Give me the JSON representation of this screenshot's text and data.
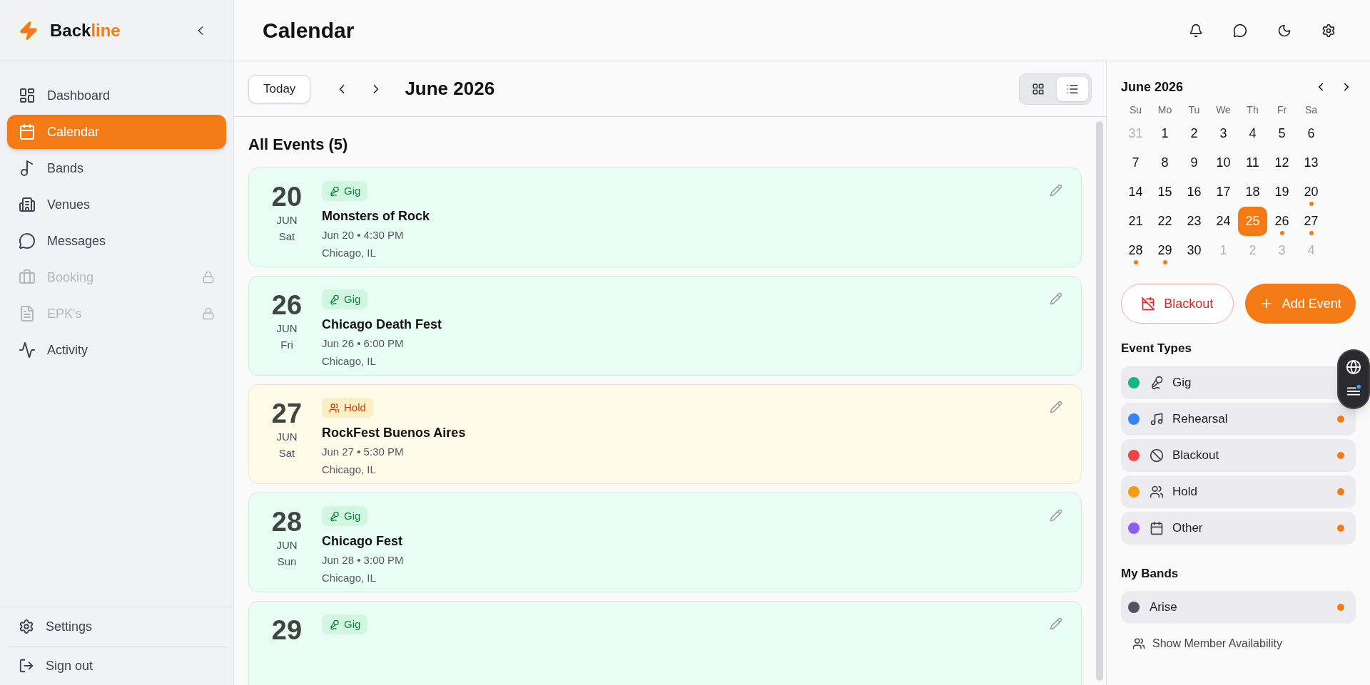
{
  "brand": {
    "primary": "Back",
    "accent": "line"
  },
  "sidebar": {
    "items": [
      {
        "label": "Dashboard",
        "selected": false,
        "locked": false
      },
      {
        "label": "Calendar",
        "selected": true,
        "locked": false
      },
      {
        "label": "Bands",
        "selected": false,
        "locked": false
      },
      {
        "label": "Venues",
        "selected": false,
        "locked": false
      },
      {
        "label": "Messages",
        "selected": false,
        "locked": false
      },
      {
        "label": "Booking",
        "selected": false,
        "locked": true
      },
      {
        "label": "EPK's",
        "selected": false,
        "locked": true
      },
      {
        "label": "Activity",
        "selected": false,
        "locked": false
      }
    ],
    "footer": [
      {
        "label": "Settings"
      },
      {
        "label": "Sign out"
      }
    ]
  },
  "page_title": "Calendar",
  "toolbar": {
    "today": "Today",
    "month": "June 2026",
    "views": [
      {
        "selected": false
      },
      {
        "selected": true
      }
    ]
  },
  "events": {
    "heading": "All Events (5)",
    "items": [
      {
        "kind": "gig",
        "day": "20",
        "month": "JUN",
        "weekday": "Sat",
        "tag": "Gig",
        "title": "Monsters of Rock",
        "time": "Jun 20 • 4:30 PM",
        "location": "Chicago, IL"
      },
      {
        "kind": "gig",
        "day": "26",
        "month": "JUN",
        "weekday": "Fri",
        "tag": "Gig",
        "title": "Chicago Death Fest",
        "time": "Jun 26 • 6:00 PM",
        "location": "Chicago, IL"
      },
      {
        "kind": "hold",
        "day": "27",
        "month": "JUN",
        "weekday": "Sat",
        "tag": "Hold",
        "title": "RockFest Buenos Aires",
        "time": "Jun 27 • 5:30 PM",
        "location": "Chicago, IL"
      },
      {
        "kind": "gig",
        "day": "28",
        "month": "JUN",
        "weekday": "Sun",
        "tag": "Gig",
        "title": "Chicago Fest",
        "time": "Jun 28 • 3:00 PM",
        "location": "Chicago, IL"
      },
      {
        "kind": "gig",
        "day": "29",
        "tag": "Gig"
      }
    ]
  },
  "mini_calendar": {
    "title": "June 2026",
    "weekdays": [
      "Su",
      "Mo",
      "Tu",
      "We",
      "Th",
      "Fr",
      "Sa"
    ],
    "weeks": [
      [
        {
          "day": "31",
          "muted": true,
          "selected": false,
          "event": false
        },
        {
          "day": "1",
          "muted": false,
          "selected": false,
          "event": false
        },
        {
          "day": "2",
          "muted": false,
          "selected": false,
          "event": false
        },
        {
          "day": "3",
          "muted": false,
          "selected": false,
          "event": false
        },
        {
          "day": "4",
          "muted": false,
          "selected": false,
          "event": false
        },
        {
          "day": "5",
          "muted": false,
          "selected": false,
          "event": false
        },
        {
          "day": "6",
          "muted": false,
          "selected": false,
          "event": false
        }
      ],
      [
        {
          "day": "7",
          "muted": false,
          "selected": false,
          "event": false
        },
        {
          "day": "8",
          "muted": false,
          "selected": false,
          "event": false
        },
        {
          "day": "9",
          "muted": false,
          "selected": false,
          "event": false
        },
        {
          "day": "10",
          "muted": false,
          "selected": false,
          "event": false
        },
        {
          "day": "11",
          "muted": false,
          "selected": false,
          "event": false
        },
        {
          "day": "12",
          "muted": false,
          "selected": false,
          "event": false
        },
        {
          "day": "13",
          "muted": false,
          "selected": false,
          "event": false
        }
      ],
      [
        {
          "day": "14",
          "muted": false,
          "selected": false,
          "event": false
        },
        {
          "day": "15",
          "muted": false,
          "selected": false,
          "event": false
        },
        {
          "day": "16",
          "muted": false,
          "selected": false,
          "event": false
        },
        {
          "day": "17",
          "muted": false,
          "selected": false,
          "event": false
        },
        {
          "day": "18",
          "muted": false,
          "selected": false,
          "event": false
        },
        {
          "day": "19",
          "muted": false,
          "selected": false,
          "event": false
        },
        {
          "day": "20",
          "muted": false,
          "selected": false,
          "event": true
        }
      ],
      [
        {
          "day": "21",
          "muted": false,
          "selected": false,
          "event": false
        },
        {
          "day": "22",
          "muted": false,
          "selected": false,
          "event": false
        },
        {
          "day": "23",
          "muted": false,
          "selected": false,
          "event": false
        },
        {
          "day": "24",
          "muted": false,
          "selected": false,
          "event": false
        },
        {
          "day": "25",
          "muted": false,
          "selected": true,
          "event": false
        },
        {
          "day": "26",
          "muted": false,
          "selected": false,
          "event": true
        },
        {
          "day": "27",
          "muted": false,
          "selected": false,
          "event": true
        }
      ],
      [
        {
          "day": "28",
          "muted": false,
          "selected": false,
          "event": true
        },
        {
          "day": "29",
          "muted": false,
          "selected": false,
          "event": true
        },
        {
          "day": "30",
          "muted": false,
          "selected": false,
          "event": false
        },
        {
          "day": "1",
          "muted": true,
          "selected": false,
          "event": false
        },
        {
          "day": "2",
          "muted": true,
          "selected": false,
          "event": false
        },
        {
          "day": "3",
          "muted": true,
          "selected": false,
          "event": false
        },
        {
          "day": "4",
          "muted": true,
          "selected": false,
          "event": false
        }
      ]
    ]
  },
  "actions": {
    "blackout": "Blackout",
    "add": "Add Event"
  },
  "event_types": {
    "heading": "Event Types",
    "items": [
      {
        "label": "Gig",
        "color": "#10b981"
      },
      {
        "label": "Rehearsal",
        "color": "#3b82f6"
      },
      {
        "label": "Blackout",
        "color": "#ef4444"
      },
      {
        "label": "Hold",
        "color": "#f59e0b"
      },
      {
        "label": "Other",
        "color": "#8b5cf6"
      }
    ]
  },
  "my_bands": {
    "heading": "My Bands",
    "items": [
      {
        "label": "Arise",
        "color": "#4b5563"
      }
    ]
  },
  "member_availability": "Show Member Availability"
}
